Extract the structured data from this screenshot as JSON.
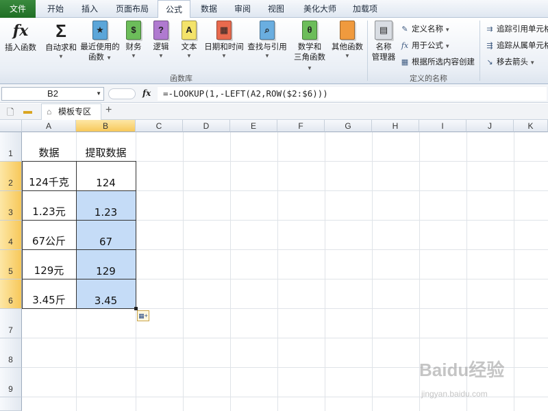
{
  "tabs": [
    {
      "label": "文件"
    },
    {
      "label": "开始"
    },
    {
      "label": "插入"
    },
    {
      "label": "页面布局"
    },
    {
      "label": "公式"
    },
    {
      "label": "数据"
    },
    {
      "label": "审阅"
    },
    {
      "label": "视图"
    },
    {
      "label": "美化大师"
    },
    {
      "label": "加载项"
    }
  ],
  "ribbon": {
    "function_library": {
      "group_label": "函数库",
      "insert_function": "插入函数",
      "autosum": "自动求和",
      "recent_line1": "最近使用的",
      "recent_line2": "函数",
      "financial": "财务",
      "logical": "逻辑",
      "text": "文本",
      "datetime": "日期和时间",
      "lookup": "查找与引用",
      "math_line1": "数学和",
      "math_line2": "三角函数",
      "other": "其他函数"
    },
    "defined_names": {
      "group_label": "定义的名称",
      "name_manager_line1": "名称",
      "name_manager_line2": "管理器",
      "define_name": "定义名称",
      "use_in_formula": "用于公式",
      "create_from_selection": "根据所选内容创建"
    },
    "auditing": {
      "trace_precedents": "追踪引用单元格",
      "trace_dependents": "追踪从属单元格",
      "remove_arrows": "移去箭头"
    }
  },
  "formula_bar": {
    "name_box": "B2",
    "fx": "fx",
    "formula": "=-LOOKUP(1,-LEFT(A2,ROW($2:$6)))"
  },
  "doc_tab": {
    "label": "模板专区",
    "add": "+"
  },
  "columns": [
    "A",
    "B",
    "C",
    "D",
    "E",
    "F",
    "G",
    "H",
    "I",
    "J",
    "K"
  ],
  "rows": [
    "1",
    "2",
    "3",
    "4",
    "5",
    "6",
    "7",
    "8",
    "9"
  ],
  "cells": {
    "A1": "数据",
    "B1": "提取数据",
    "A2": "124千克",
    "B2": "124",
    "A3": "1.23元",
    "B3": "1.23",
    "A4": "67公斤",
    "B4": "67",
    "A5": "129元",
    "B5": "129",
    "A6": "3.45斤",
    "B6": "3.45"
  },
  "watermark": {
    "main": "Baidu经验",
    "sub": "jingyan.baidu.com"
  }
}
